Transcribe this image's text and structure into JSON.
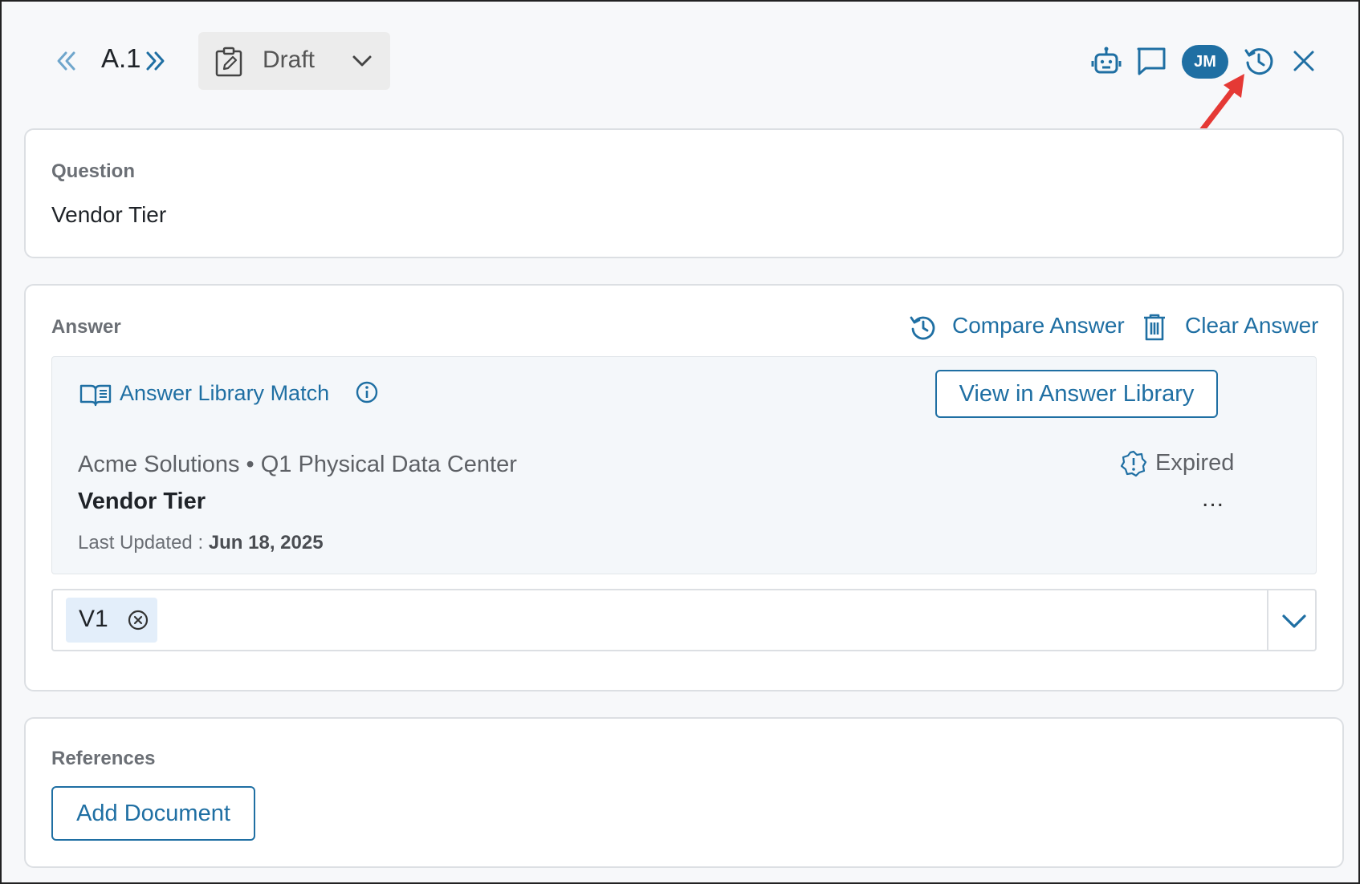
{
  "header": {
    "item_id": "A.1",
    "status": "Draft",
    "avatar_initials": "JM",
    "prev_icon": "double-chevron-left-icon",
    "next_icon": "double-chevron-right-icon",
    "actions": [
      "robot-icon",
      "comment-icon",
      "avatar",
      "history-icon",
      "close-icon"
    ]
  },
  "question": {
    "title": "Question",
    "text": "Vendor Tier"
  },
  "answer": {
    "title": "Answer",
    "compare_label": "Compare Answer",
    "clear_label": "Clear Answer",
    "match": {
      "heading": "Answer Library Match",
      "view_button": "View in Answer Library",
      "source": "Acme Solutions • Q1 Physical Data Center",
      "status": "Expired",
      "title": "Vendor Tier",
      "more": "...",
      "updated_label": "Last Updated :",
      "updated_date": "Jun 18, 2025"
    },
    "selected_value": "V1"
  },
  "references": {
    "title": "References",
    "add_button": "Add Document"
  },
  "colors": {
    "accent": "#1f6fa3",
    "annotation": "#e53935"
  }
}
